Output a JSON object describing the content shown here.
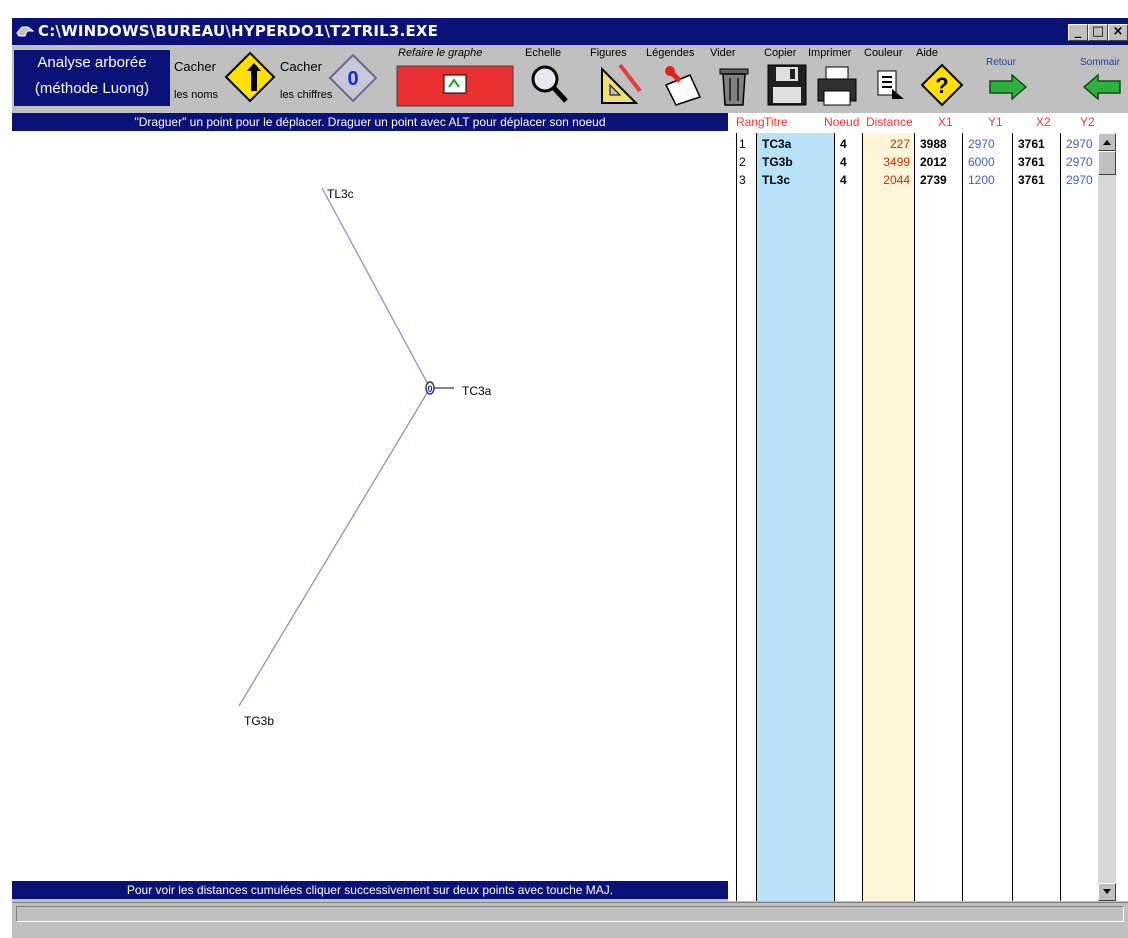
{
  "window": {
    "title": "C:\\WINDOWS\\BUREAU\\HYPERDO1\\T2TRIL3.EXE",
    "controls": {
      "minimize": "_",
      "maximize": "□",
      "close": "×"
    }
  },
  "toolbar": {
    "analyse_line1": "Analyse arborée",
    "analyse_line2": "(méthode Luong)",
    "cacher_noms_1": "Cacher",
    "cacher_noms_2": "les noms",
    "cacher_chiffres_1": "Cacher",
    "cacher_chiffres_2": "les chiffres",
    "chiffre_icon_text": "0",
    "refaire": "Refaire le graphe",
    "echelle": "Echelle",
    "figures": "Figures",
    "legendes": "Légendes",
    "vider": "Vider",
    "copier": "Copier",
    "imprimer": "Imprimer",
    "couleur": "Couleur",
    "aide": "Aide",
    "aide_icon_text": "?",
    "retour": "Retour",
    "sommaire": "Sommair"
  },
  "hint_top": "\"Draguer\" un point pour le déplacer. Draguer un point avec ALT pour déplacer son noeud",
  "hint_bottom": "Pour voir les distances cumulées cliquer successivement sur deux points avec touche MAJ.",
  "graph": {
    "node_label": "0",
    "points": [
      {
        "name": "TC3a"
      },
      {
        "name": "TG3b"
      },
      {
        "name": "TL3c"
      }
    ]
  },
  "table": {
    "headers": [
      "Rang",
      "Titre",
      "Noeud",
      "Distance",
      "X1",
      "Y1",
      "X2",
      "Y2"
    ],
    "rows": [
      {
        "rang": "1",
        "titre": "TC3a",
        "noeud": "4",
        "distance": "227",
        "x1": "3988",
        "y1": "2970",
        "x2": "3761",
        "y2": "2970"
      },
      {
        "rang": "2",
        "titre": "TG3b",
        "noeud": "4",
        "distance": "3499",
        "x1": "2012",
        "y1": "6000",
        "x2": "3761",
        "y2": "2970"
      },
      {
        "rang": "3",
        "titre": "TL3c",
        "noeud": "4",
        "distance": "2044",
        "x1": "2739",
        "y1": "1200",
        "x2": "3761",
        "y2": "2970"
      }
    ]
  },
  "colors": {
    "titlebar": "#0a1278",
    "title_column": "#b8e2f8",
    "distance_column": "#fff5d8",
    "header_text": "#ff3030",
    "distance_text": "#c83000",
    "y_text": "#4060c0",
    "edge": "#8a90d8"
  }
}
